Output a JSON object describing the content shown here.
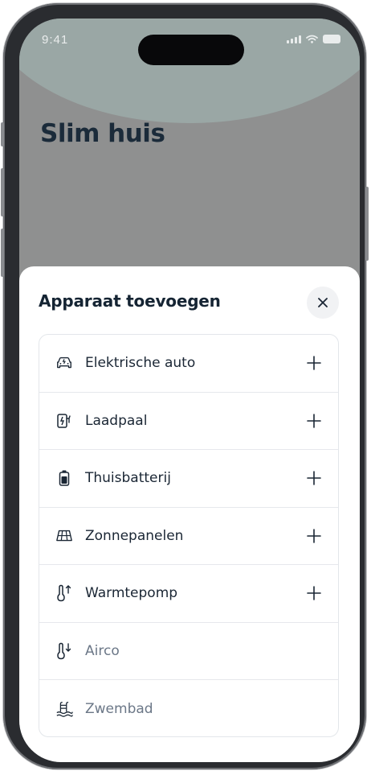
{
  "status_bar": {
    "time": "9:41"
  },
  "page": {
    "title": "Slim huis"
  },
  "sheet": {
    "title": "Apparaat toevoegen",
    "close_icon": "close-icon",
    "items": [
      {
        "label": "Elektrische auto",
        "icon": "electric-car-icon",
        "enabled": true
      },
      {
        "label": "Laadpaal",
        "icon": "charging-station-icon",
        "enabled": true
      },
      {
        "label": "Thuisbatterij",
        "icon": "battery-icon",
        "enabled": true
      },
      {
        "label": "Zonnepanelen",
        "icon": "solar-panel-icon",
        "enabled": true
      },
      {
        "label": "Warmtepomp",
        "icon": "heat-pump-icon",
        "enabled": true
      },
      {
        "label": "Airco",
        "icon": "airco-icon",
        "enabled": false
      },
      {
        "label": "Zwembad",
        "icon": "swimming-pool-icon",
        "enabled": false
      }
    ]
  },
  "colors": {
    "title_text": "#1b2b3a",
    "disabled_text": "#6b7787",
    "sheet_bg": "#ffffff"
  }
}
